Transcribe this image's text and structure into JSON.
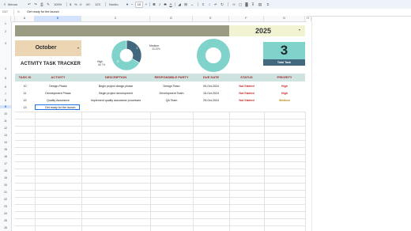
{
  "toolbar": {
    "menu_label": "Menus",
    "zoom": "100%",
    "currency": "$",
    "percent": "%",
    "decimals_dec": ".0",
    "decimals_inc": ".00",
    "number_format": "123",
    "font_name": "Nunito",
    "font_size": "10"
  },
  "formula_bar": {
    "cell_ref": "C17",
    "fx": "fx",
    "content": "Get ready for the launch"
  },
  "columns": [
    "A",
    "B",
    "C",
    "D",
    "E",
    "F",
    "G",
    "H"
  ],
  "rows": [
    "1",
    "2",
    "3",
    "4",
    "5",
    "6",
    "7",
    "8",
    "9",
    "10",
    "11",
    "12",
    "13",
    "14",
    "15",
    "16",
    "17",
    "18",
    "19",
    "20",
    "21",
    "22",
    "23",
    "24",
    "25",
    "26",
    "27",
    "28",
    "29",
    "30",
    "31",
    "32",
    "33",
    "34",
    "35",
    "36",
    "37",
    "38",
    "39",
    "40"
  ],
  "sheet": {
    "year": "2025",
    "month": "October",
    "title": "ACTIVITY TASK TRACKER",
    "total_value": "3",
    "total_label": "Total Task"
  },
  "donut": {
    "medium_label": "Medium",
    "medium_pct": "33.33%",
    "high_label": "High",
    "high_pct": "66.7%",
    "center_value": "2",
    "slice_value": "1",
    "colors": {
      "high": "#7fd3cb",
      "medium": "#41687c"
    },
    "fractions": {
      "high": 0.6667,
      "medium": 0.3333
    }
  },
  "table": {
    "headers": [
      "TASK ID",
      "ACTIVITY",
      "DESCRIPTION",
      "RESPONSIBLE PARTY",
      "DUE DATE",
      "STATUS",
      "PRIORITY"
    ],
    "rows": [
      {
        "id": "10",
        "activity": "Design Phase",
        "description": "Begin project design phase",
        "party": "Design Team",
        "due": "05-Oct-2024",
        "status": "Not Started",
        "priority": "High"
      },
      {
        "id": "11",
        "activity": "Development Phase",
        "description": "Begin project development",
        "party": "Development Team",
        "due": "15-Oct-2024",
        "status": "Not Started",
        "priority": "High"
      },
      {
        "id": "12",
        "activity": "Quality Assurance",
        "description": "Implement quality assurance processes",
        "party": "QA Team",
        "due": "25-Oct-2024",
        "status": "Not Started",
        "priority": "Medium"
      },
      {
        "id": "13",
        "activity": "Get ready for the launch",
        "description": "",
        "party": "",
        "due": "",
        "status": "",
        "priority": ""
      }
    ]
  },
  "colors": {
    "banner": "#9b9b84",
    "card": "#ebd5b3",
    "teal": "#7fd3cb",
    "header_text": "#9e2a2b",
    "status_red": "#c62828",
    "priority_high": "#c62828",
    "priority_medium": "#b8860b"
  }
}
